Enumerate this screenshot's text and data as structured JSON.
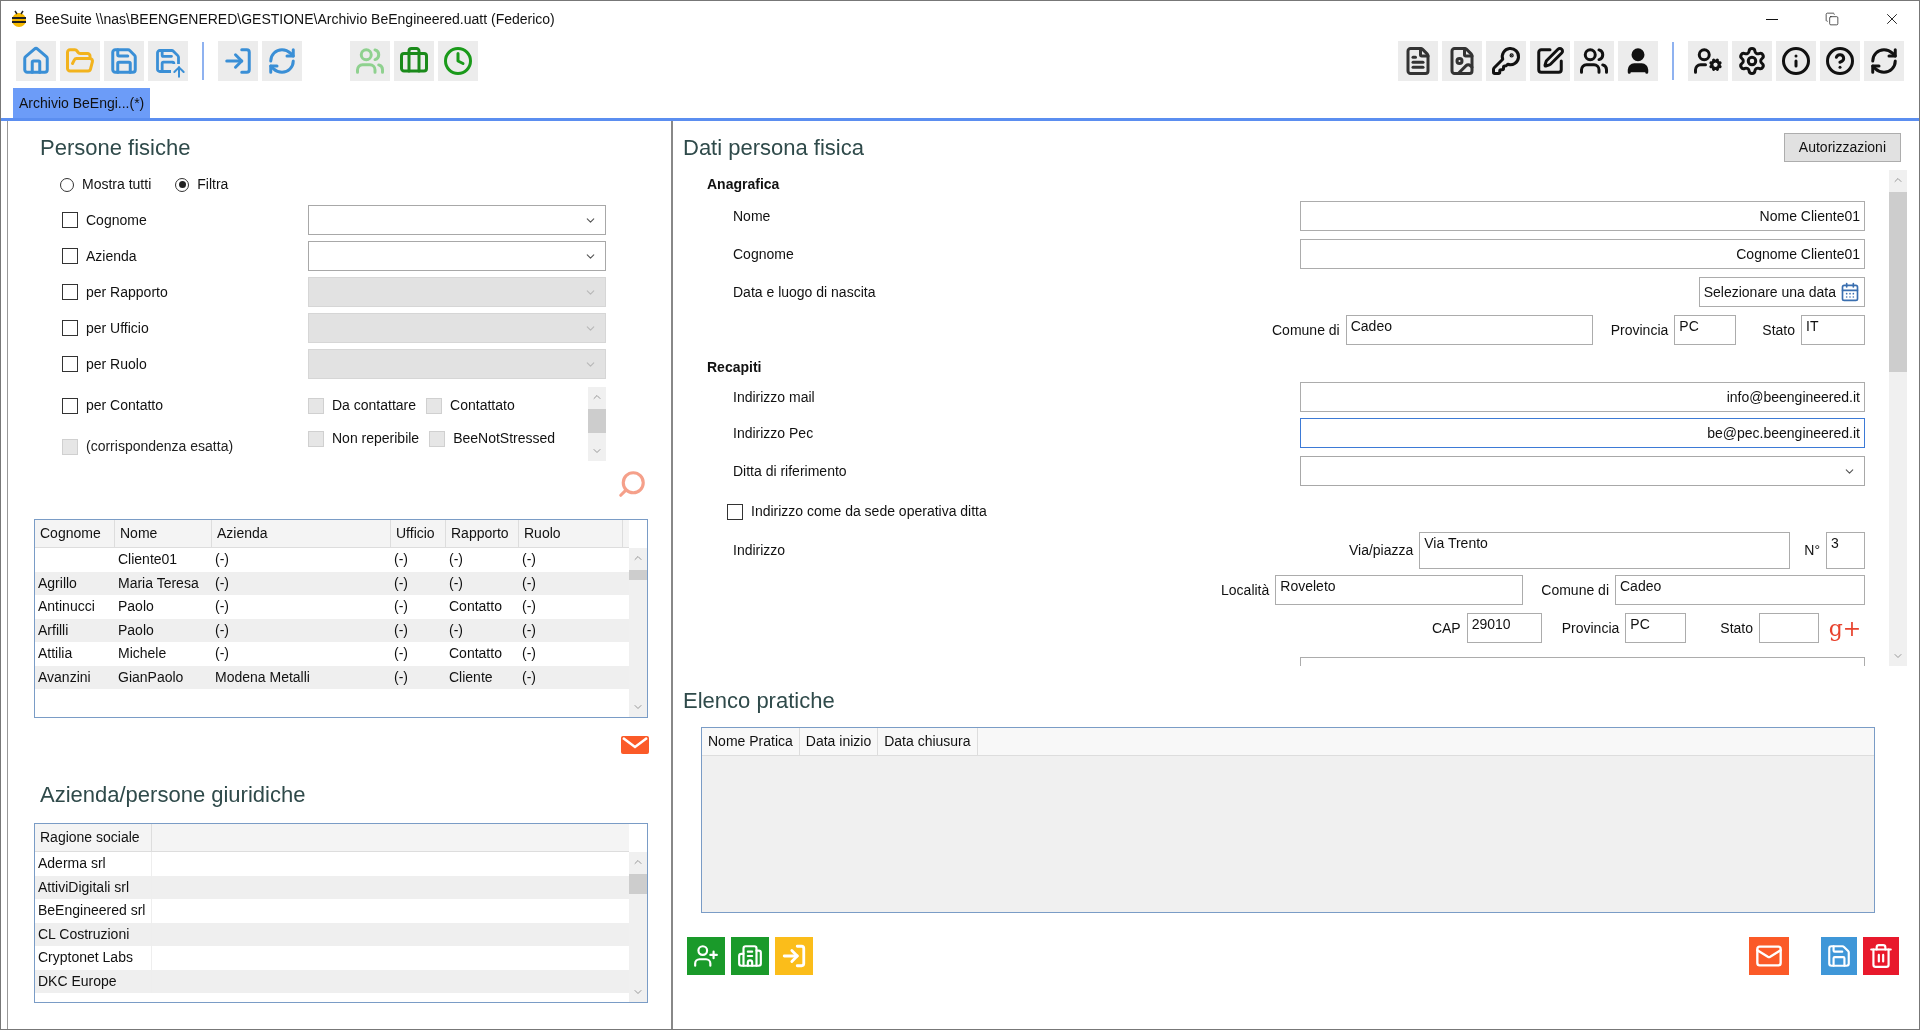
{
  "window": {
    "title": "BeeSuite \\\\nas\\BEENGENERED\\GESTIONE\\Archivio BeEngineered.uatt (Federico)"
  },
  "tabs": [
    {
      "label": "Archivio BeEngi...(*)",
      "selected": true
    }
  ],
  "persone_fisiche": {
    "title": "Persone fisiche",
    "radios": [
      {
        "label": "Mostra tutti",
        "selected": false
      },
      {
        "label": "Filtra",
        "selected": true
      }
    ],
    "filters": [
      {
        "label": "Cognome",
        "checked": false,
        "disabled": false
      },
      {
        "label": "Azienda",
        "checked": false,
        "disabled": false
      },
      {
        "label": "per Rapporto",
        "checked": false,
        "disabled": true
      },
      {
        "label": "per Ufficio",
        "checked": false,
        "disabled": true
      },
      {
        "label": "per Ruolo",
        "checked": false,
        "disabled": true
      }
    ],
    "contact_filter": {
      "label": "per Contatto",
      "checked": false
    },
    "contact_options": [
      {
        "label": "Da contattare",
        "checked": false
      },
      {
        "label": "Contattato",
        "checked": false
      },
      {
        "label": "Non reperibile",
        "checked": false
      },
      {
        "label": "BeeNotStressed",
        "checked": false
      }
    ],
    "exact_match": {
      "label": "(corrispondenza esatta)",
      "checked": false,
      "disabled": true
    },
    "table": {
      "columns": [
        "Cognome",
        "Nome",
        "Azienda",
        "Ufficio",
        "Rapporto",
        "Ruolo"
      ],
      "rows": [
        [
          "",
          "Cliente01",
          "(-)",
          "(-)",
          "(-)",
          "(-)"
        ],
        [
          "Agrillo",
          "Maria Teresa",
          "(-)",
          "(-)",
          "(-)",
          "(-)"
        ],
        [
          "Antinucci",
          "Paolo",
          "(-)",
          "(-)",
          "Contatto",
          "(-)"
        ],
        [
          "Arfilli",
          "Paolo",
          "(-)",
          "(-)",
          "(-)",
          "(-)"
        ],
        [
          "Attilia",
          "Michele",
          "(-)",
          "(-)",
          "Contatto",
          "(-)"
        ],
        [
          "Avanzini",
          "GianPaolo",
          "Modena Metalli",
          "(-)",
          "Cliente",
          "(-)"
        ]
      ]
    }
  },
  "aziende": {
    "title": "Azienda/persone giuridiche",
    "columns": [
      "Ragione sociale"
    ],
    "rows": [
      "Aderma srl",
      "AttiviDigitali srl",
      "BeEngineered srl",
      "CL Costruzioni",
      "Cryptonet Labs",
      "DKC Europe"
    ]
  },
  "dati_persona": {
    "title": "Dati persona fisica",
    "button": "Autorizzazioni",
    "anagrafica": {
      "heading": "Anagrafica",
      "nome": {
        "label": "Nome",
        "value": "Nome Cliente01"
      },
      "cognome": {
        "label": "Cognome",
        "value": "Cognome Cliente01"
      },
      "nascita": {
        "label": "Data e luogo di nascita",
        "date_placeholder": "Selezionare una data"
      },
      "comune": {
        "label": "Comune di",
        "value": "Cadeo"
      },
      "provincia": {
        "label": "Provincia",
        "value": "PC"
      },
      "stato": {
        "label": "Stato",
        "value": "IT"
      }
    },
    "recapiti": {
      "heading": "Recapiti",
      "mail": {
        "label": "Indirizzo mail",
        "value": "info@beengineered.it",
        "focused": false
      },
      "pec": {
        "label": "Indirizzo Pec",
        "value": "be@pec.beengineered.it",
        "focused": true
      },
      "ditta": {
        "label": "Ditta di riferimento"
      },
      "sede": {
        "label": "Indirizzo come da sede operativa ditta",
        "checked": false
      },
      "indirizzo": {
        "label": "Indirizzo"
      },
      "via": {
        "label": "Via/piazza",
        "value": "Via Trento"
      },
      "numero": {
        "label": "N°",
        "value": "3"
      },
      "localita": {
        "label": "Località",
        "value": "Roveleto"
      },
      "comune": {
        "label": "Comune di",
        "value": "Cadeo"
      },
      "cap": {
        "label": "CAP",
        "value": "29010"
      },
      "provincia": {
        "label": "Provincia",
        "value": "PC"
      },
      "stato": {
        "label": "Stato"
      },
      "social_button": "g+"
    }
  },
  "pratiche": {
    "title": "Elenco pratiche",
    "columns": [
      "Nome Pratica",
      "Data inizio",
      "Data chiusura"
    ]
  }
}
